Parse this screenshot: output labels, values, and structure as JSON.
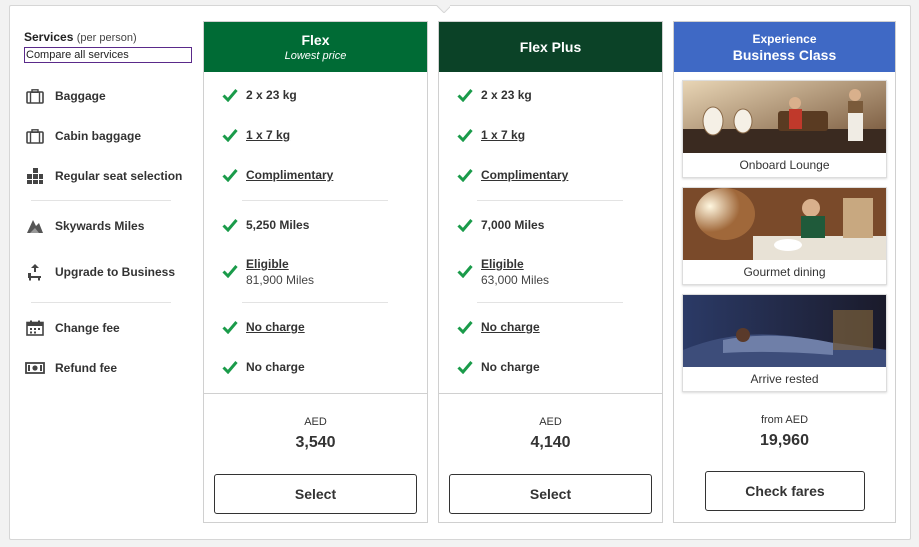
{
  "services": {
    "title": "Services",
    "per_person": "(per person)",
    "compare_link": "Compare all services",
    "items": [
      {
        "label": "Baggage",
        "icon": "suitcase-icon"
      },
      {
        "label": "Cabin baggage",
        "icon": "cabin-bag-icon"
      },
      {
        "label": "Regular seat selection",
        "icon": "seat-icon"
      },
      {
        "label": "Skywards Miles",
        "icon": "skywards-icon"
      },
      {
        "label": "Upgrade to Business",
        "icon": "upgrade-seat-icon"
      },
      {
        "label": "Change fee",
        "icon": "calendar-icon"
      },
      {
        "label": "Refund fee",
        "icon": "banknote-icon"
      }
    ]
  },
  "fares": [
    {
      "name": "Flex",
      "subtitle": "Lowest price",
      "header_color": "#006b35",
      "baggage": "2 x 23 kg",
      "cabin": "1 x 7 kg",
      "seat": "Complimentary",
      "miles": "5,250 Miles",
      "upgrade": "Eligible",
      "upgrade_miles": "81,900 Miles",
      "change": "No charge",
      "refund": "No charge",
      "currency": "AED",
      "price": "3,540",
      "button": "Select"
    },
    {
      "name": "Flex Plus",
      "subtitle": "",
      "header_color": "#0b4227",
      "baggage": "2 x 23 kg",
      "cabin": "1 x 7 kg",
      "seat": "Complimentary",
      "miles": "7,000 Miles",
      "upgrade": "Eligible",
      "upgrade_miles": "63,000 Miles",
      "change": "No charge",
      "refund": "No charge",
      "currency": "AED",
      "price": "4,140",
      "button": "Select"
    }
  ],
  "experience": {
    "title_line1": "Experience",
    "title_line2": "Business Class",
    "header_color": "#3f69c5",
    "cards": [
      {
        "caption": "Onboard Lounge"
      },
      {
        "caption": "Gourmet dining"
      },
      {
        "caption": "Arrive rested"
      }
    ],
    "from_label": "from AED",
    "price": "19,960",
    "button": "Check fares"
  },
  "check_color": "#1a9b4a"
}
